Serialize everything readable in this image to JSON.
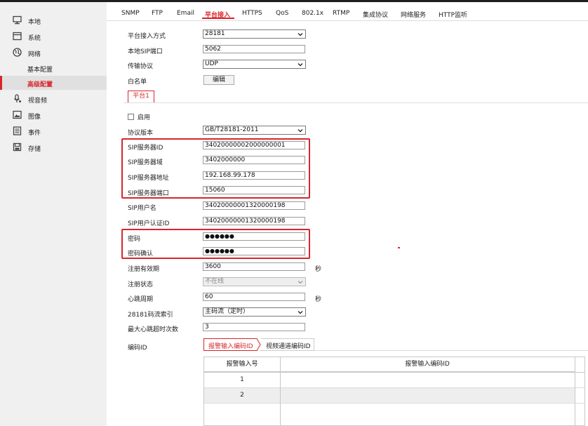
{
  "sidebar": {
    "items": [
      {
        "label": "本地",
        "icon": "monitor-icon"
      },
      {
        "label": "系统",
        "icon": "system-icon"
      },
      {
        "label": "网络",
        "icon": "globe-icon"
      },
      {
        "label": "基本配置"
      },
      {
        "label": "高级配置"
      },
      {
        "label": "视音频",
        "icon": "microphone-icon"
      },
      {
        "label": "图像",
        "icon": "image-icon"
      },
      {
        "label": "事件",
        "icon": "event-list-icon"
      },
      {
        "label": "存储",
        "icon": "storage-icon"
      }
    ],
    "active_color": "#d7262b"
  },
  "tabs": [
    "SNMP",
    "FTP",
    "Email",
    "平台接入",
    "HTTPS",
    "QoS",
    "802.1x",
    "RTMP",
    "集成协议",
    "网络服务",
    "HTTP监听"
  ],
  "active_tab": "平台接入",
  "form": {
    "access_mode": {
      "label": "平台接入方式",
      "value": "28181"
    },
    "local_sip_port": {
      "label": "本地SIP端口",
      "value": "5062"
    },
    "transport": {
      "label": "传输协议",
      "value": "UDP"
    },
    "whitelist": {
      "label": "白名单",
      "button": "编辑"
    },
    "platform_tab": "平台1",
    "enable": {
      "label": "启用"
    },
    "protocol_version": {
      "label": "协议版本",
      "value": "GB/T28181-2011"
    },
    "sip_server_id": {
      "label": "SIP服务器ID",
      "value": "34020000002000000001"
    },
    "sip_server_domain": {
      "label": "SIP服务器域",
      "value": "3402000000"
    },
    "sip_server_address": {
      "label": "SIP服务器地址",
      "value": "192.168.99.178"
    },
    "sip_server_port": {
      "label": "SIP服务器端口",
      "value": "15060"
    },
    "sip_username": {
      "label": "SIP用户名",
      "value": "34020000001320000198"
    },
    "sip_auth_id": {
      "label": "SIP用户认证ID",
      "value": "34020000001320000198"
    },
    "password": {
      "label": "密码",
      "value": "●●●●●●"
    },
    "password_confirm": {
      "label": "密码确认",
      "value": "●●●●●●"
    },
    "register_validity": {
      "label": "注册有效期",
      "value": "3600",
      "unit": "秒"
    },
    "register_status": {
      "label": "注册状态",
      "value": "不在线"
    },
    "heartbeat_period": {
      "label": "心跳周期",
      "value": "60",
      "unit": "秒"
    },
    "stream_index": {
      "label": "28181码流索引",
      "value": "主码流（定时）"
    },
    "max_heartbeat_timeout": {
      "label": "最大心跳超时次数",
      "value": "3"
    },
    "encode_id": {
      "label": "编码ID",
      "tabs": [
        "报警输入编码ID",
        "视频通道编码ID"
      ]
    }
  },
  "alarm_table": {
    "headers": [
      "报警输入号",
      "报警输入编码ID"
    ],
    "rows": [
      {
        "no": "1",
        "id": ""
      },
      {
        "no": "2",
        "id": ""
      }
    ]
  }
}
